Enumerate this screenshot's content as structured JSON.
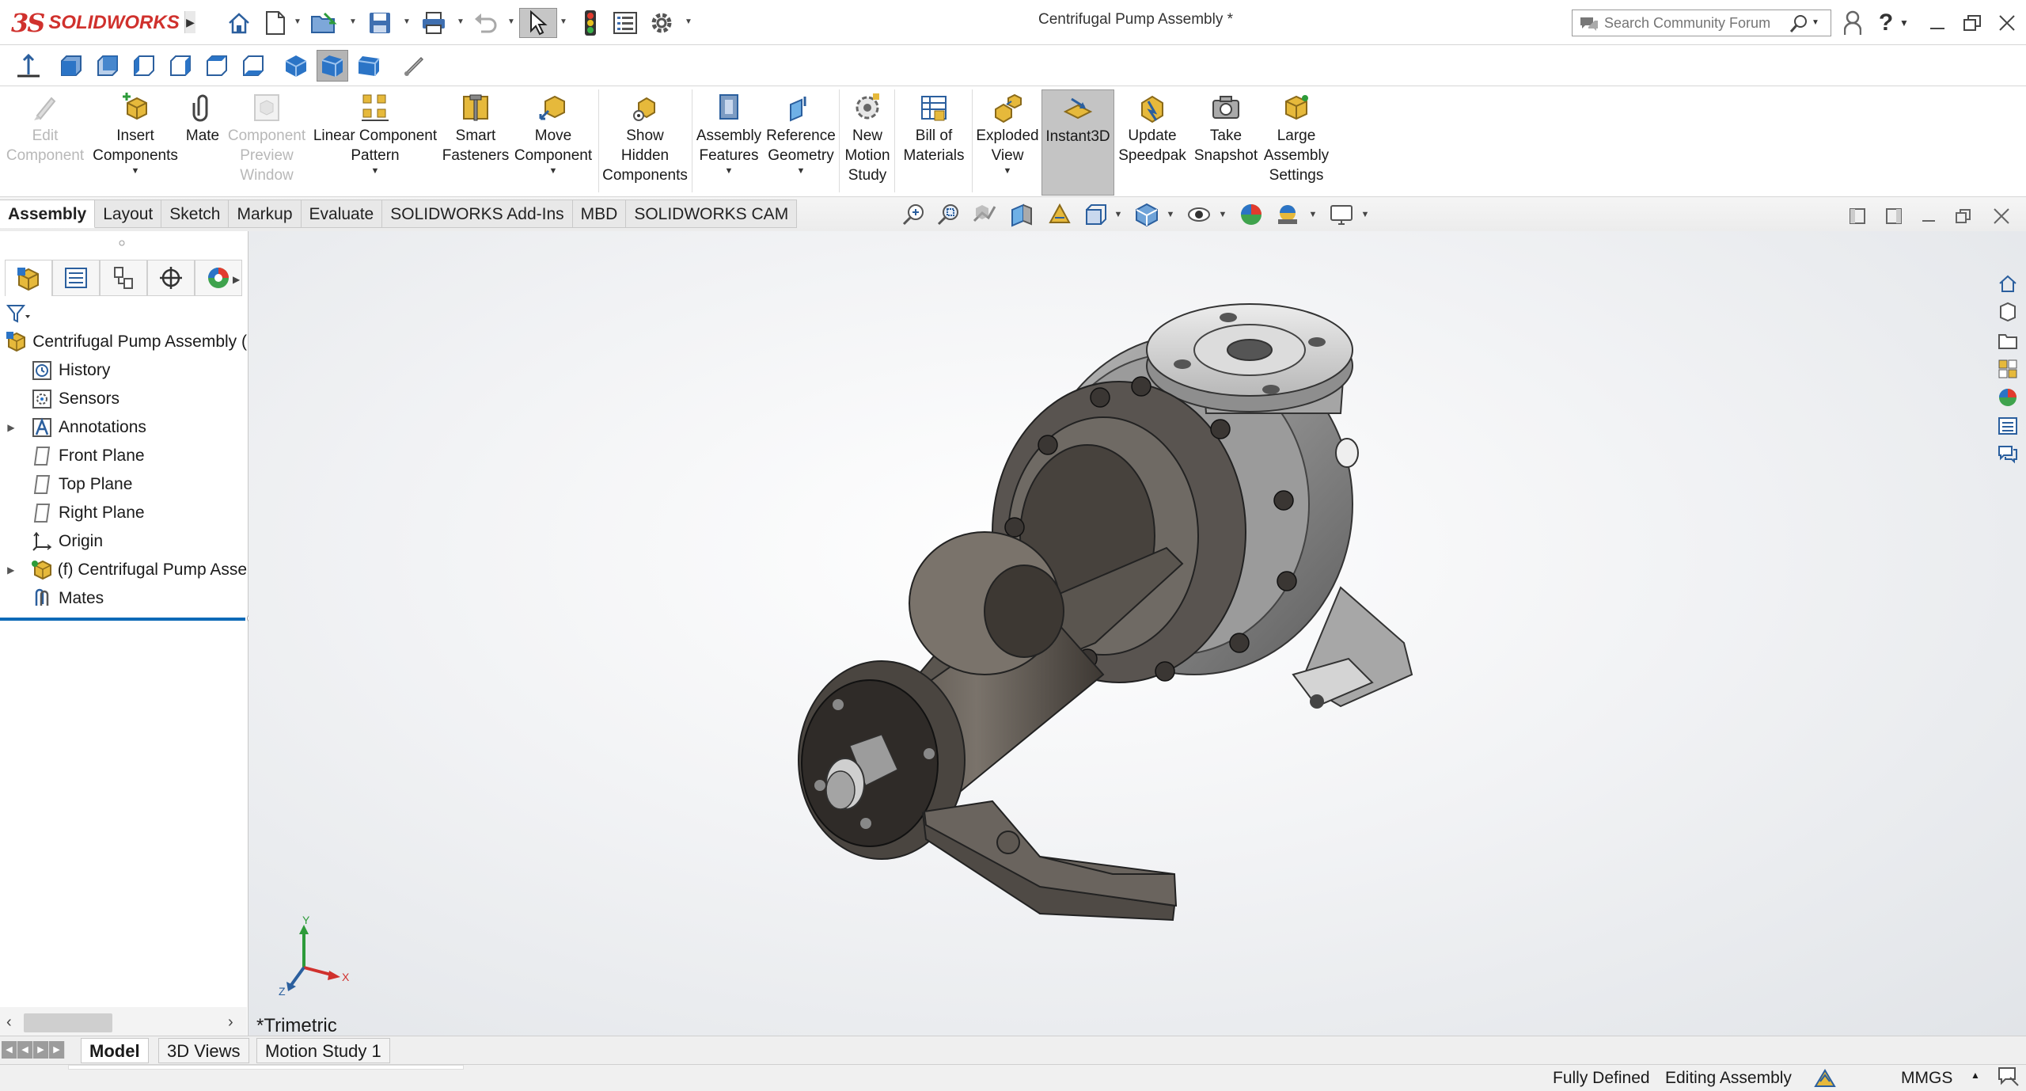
{
  "app": {
    "brand": "SOLIDWORKS",
    "brand_prefix": "3S",
    "document_title": "Centrifugal Pump Assembly *"
  },
  "search": {
    "placeholder": "Search Community Forum"
  },
  "commands": [
    {
      "id": "edit-component",
      "label": "Edit Component",
      "lines": [
        "Edit",
        "Component"
      ],
      "disabled": true
    },
    {
      "id": "insert-components",
      "label": "Insert Components",
      "lines": [
        "Insert",
        "Components"
      ],
      "dropdown": true
    },
    {
      "id": "mate",
      "label": "Mate",
      "lines": [
        "Mate"
      ]
    },
    {
      "id": "component-preview-window",
      "label": "Component Preview Window",
      "lines": [
        "Component",
        "Preview",
        "Window"
      ],
      "disabled": true
    },
    {
      "id": "linear-component-pattern",
      "label": "Linear Component Pattern",
      "lines": [
        "Linear Component",
        "Pattern"
      ],
      "dropdown": true
    },
    {
      "id": "smart-fasteners",
      "label": "Smart Fasteners",
      "lines": [
        "Smart",
        "Fasteners"
      ]
    },
    {
      "id": "move-component",
      "label": "Move Component",
      "lines": [
        "Move",
        "Component"
      ],
      "dropdown": true
    },
    {
      "id": "show-hidden-components",
      "label": "Show Hidden Components",
      "lines": [
        "Show",
        "Hidden",
        "Components"
      ]
    },
    {
      "id": "assembly-features",
      "label": "Assembly Features",
      "lines": [
        "Assembly",
        "Features"
      ],
      "dropdown": true
    },
    {
      "id": "reference-geometry",
      "label": "Reference Geometry",
      "lines": [
        "Reference",
        "Geometry"
      ],
      "dropdown": true
    },
    {
      "id": "new-motion-study",
      "label": "New Motion Study",
      "lines": [
        "New",
        "Motion",
        "Study"
      ]
    },
    {
      "id": "bill-of-materials",
      "label": "Bill of Materials",
      "lines": [
        "Bill of",
        "Materials"
      ]
    },
    {
      "id": "exploded-view",
      "label": "Exploded View",
      "lines": [
        "Exploded",
        "View"
      ],
      "dropdown": true
    },
    {
      "id": "instant3d",
      "label": "Instant3D",
      "lines": [
        "Instant3D"
      ],
      "active": true
    },
    {
      "id": "update-speedpak",
      "label": "Update Speedpak",
      "lines": [
        "Update",
        "Speedpak"
      ]
    },
    {
      "id": "take-snapshot",
      "label": "Take Snapshot",
      "lines": [
        "Take",
        "Snapshot"
      ]
    },
    {
      "id": "large-assembly-settings",
      "label": "Large Assembly Settings",
      "lines": [
        "Large",
        "Assembly",
        "Settings"
      ]
    }
  ],
  "tabs": [
    {
      "label": "Assembly",
      "active": true
    },
    {
      "label": "Layout"
    },
    {
      "label": "Sketch"
    },
    {
      "label": "Markup"
    },
    {
      "label": "Evaluate"
    },
    {
      "label": "SOLIDWORKS Add-Ins"
    },
    {
      "label": "MBD"
    },
    {
      "label": "SOLIDWORKS CAM"
    }
  ],
  "feature_tree": [
    {
      "label": "Centrifugal Pump Assembly  (",
      "icon": "assembly-icon",
      "level": 0
    },
    {
      "label": "History",
      "icon": "history-icon",
      "level": 1
    },
    {
      "label": "Sensors",
      "icon": "sensors-icon",
      "level": 1
    },
    {
      "label": "Annotations",
      "icon": "annotations-icon",
      "level": 1,
      "expandable": true
    },
    {
      "label": "Front Plane",
      "icon": "plane-icon",
      "level": 1
    },
    {
      "label": "Top Plane",
      "icon": "plane-icon",
      "level": 1
    },
    {
      "label": "Right Plane",
      "icon": "plane-icon",
      "level": 1
    },
    {
      "label": "Origin",
      "icon": "origin-icon",
      "level": 1
    },
    {
      "label": "(f) Centrifugal Pump Asse",
      "icon": "subassembly-icon",
      "level": 1,
      "expandable": true
    },
    {
      "label": "Mates",
      "icon": "mates-icon",
      "level": 1
    }
  ],
  "viewport": {
    "view_orientation": "*Trimetric",
    "triad": {
      "x": "X",
      "y": "Y",
      "z": "Z"
    }
  },
  "bottom_tabs": [
    {
      "label": "Model",
      "active": true
    },
    {
      "label": "3D Views"
    },
    {
      "label": "Motion Study 1"
    }
  ],
  "status": {
    "definition": "Fully Defined",
    "mode": "Editing Assembly",
    "units": "MMGS"
  },
  "colors": {
    "brand_red": "#d0312d",
    "selection_blue": "#0e6ab7",
    "active_cmd": "#c4c4c4"
  }
}
